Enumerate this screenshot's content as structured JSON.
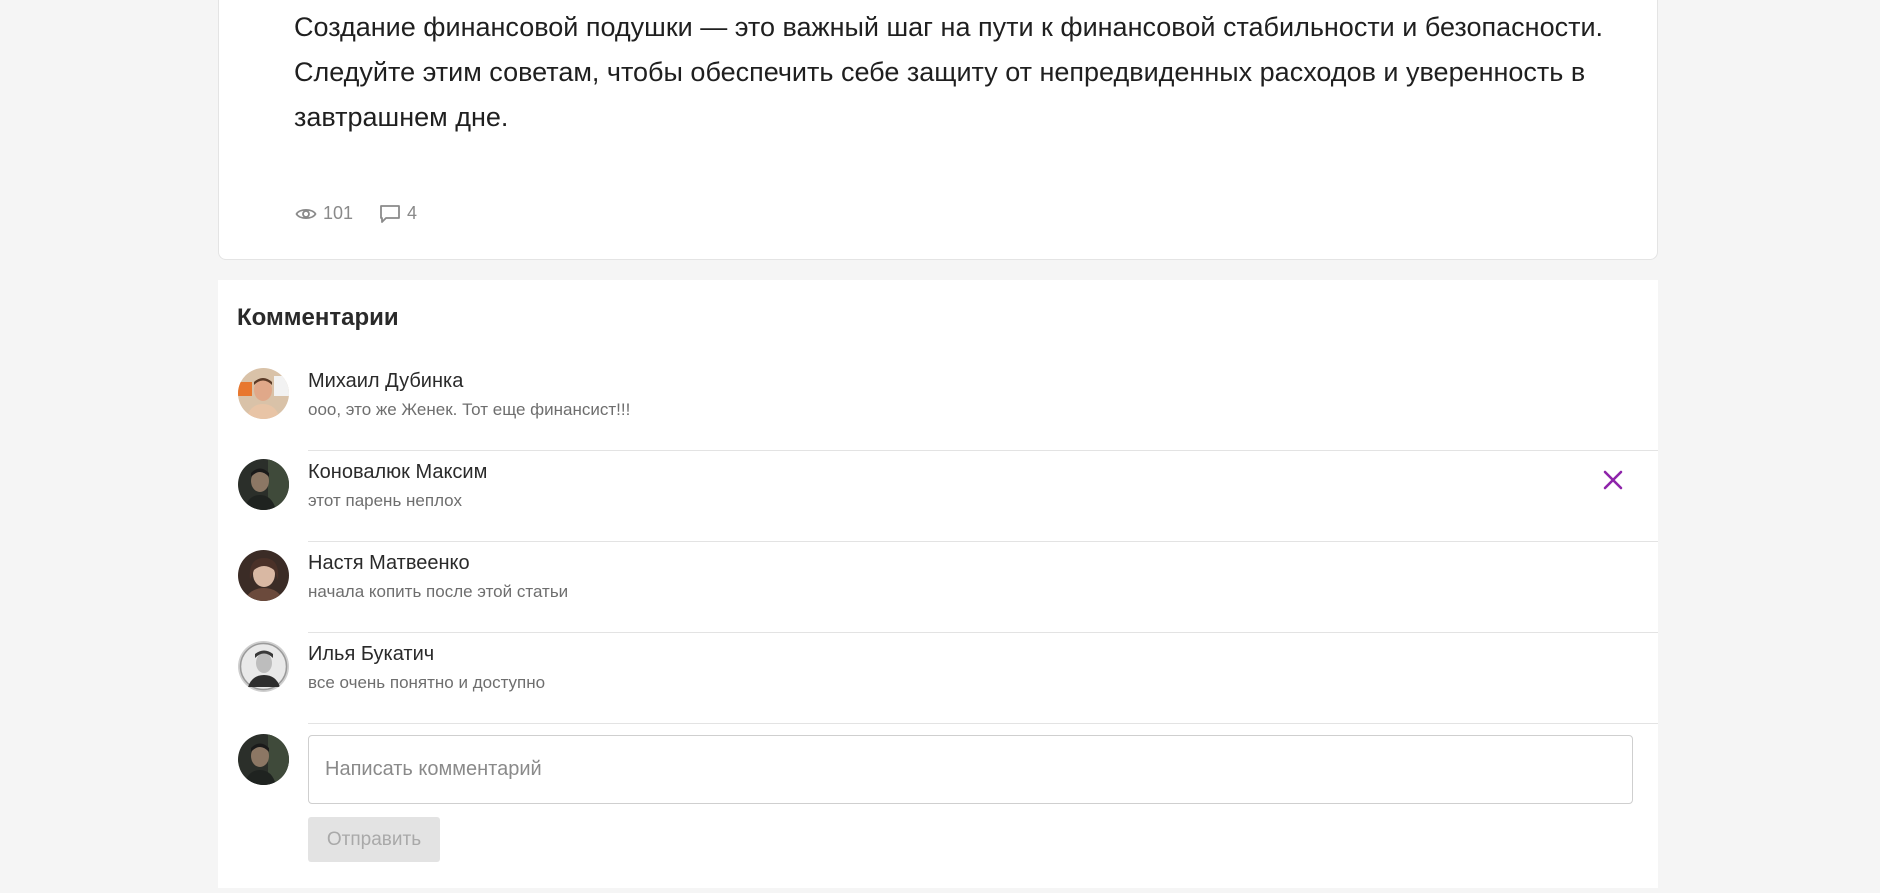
{
  "article": {
    "text": "Создание финансовой подушки — это важный шаг на пути к финансовой стабильности и безопасности. Следуйте этим советам, чтобы обеспечить себе защиту от непредвиденных расходов и уверенность в завтрашнем дне.",
    "views": "101",
    "comments_count": "4"
  },
  "comments": {
    "title": "Комментарии",
    "items": [
      {
        "author": "Михаил Дубинка",
        "text": "ооо, это же Женек. Тот еще финансист!!!"
      },
      {
        "author": "Коновалюк Максим",
        "text": "этот парень неплох"
      },
      {
        "author": "Настя Матвеенко",
        "text": "начала копить после этой статьи"
      },
      {
        "author": "Илья Бука­тич",
        "text": "все очень понятно и доступно"
      }
    ]
  },
  "form": {
    "placeholder": "Написать комментарий",
    "submit_label": "Отправить"
  },
  "icons": {
    "views": "eye-icon",
    "comments": "comment-bubble-icon",
    "delete": "close-icon"
  },
  "colors": {
    "accent": "#8e24aa",
    "muted_text": "#8a8a8a",
    "button_disabled_bg": "#e3e3e3"
  }
}
